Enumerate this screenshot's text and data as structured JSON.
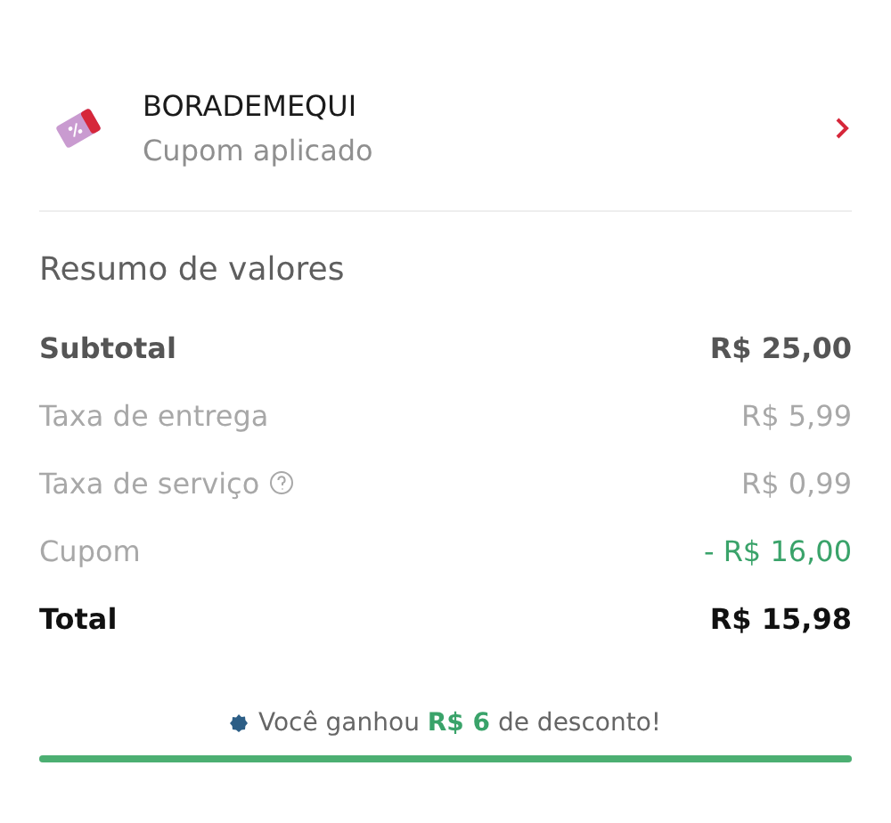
{
  "coupon": {
    "code": "BORADEMEQUI",
    "status": "Cupom aplicado"
  },
  "summary": {
    "title": "Resumo de valores",
    "rows": [
      {
        "kind": "strong",
        "label": "Subtotal",
        "value": "R$ 25,00",
        "help": false
      },
      {
        "kind": "muted",
        "label": "Taxa de entrega",
        "value": "R$ 5,99",
        "help": false
      },
      {
        "kind": "muted",
        "label": "Taxa de serviço",
        "value": "R$ 0,99",
        "help": true
      },
      {
        "kind": "discount",
        "label": "Cupom",
        "value": "- R$ 16,00",
        "help": false
      },
      {
        "kind": "total",
        "label": "Total",
        "value": "R$ 15,98",
        "help": false
      }
    ]
  },
  "savings": {
    "message": "Você ganhou **R$ 6** de desconto!",
    "level": 1
  }
}
